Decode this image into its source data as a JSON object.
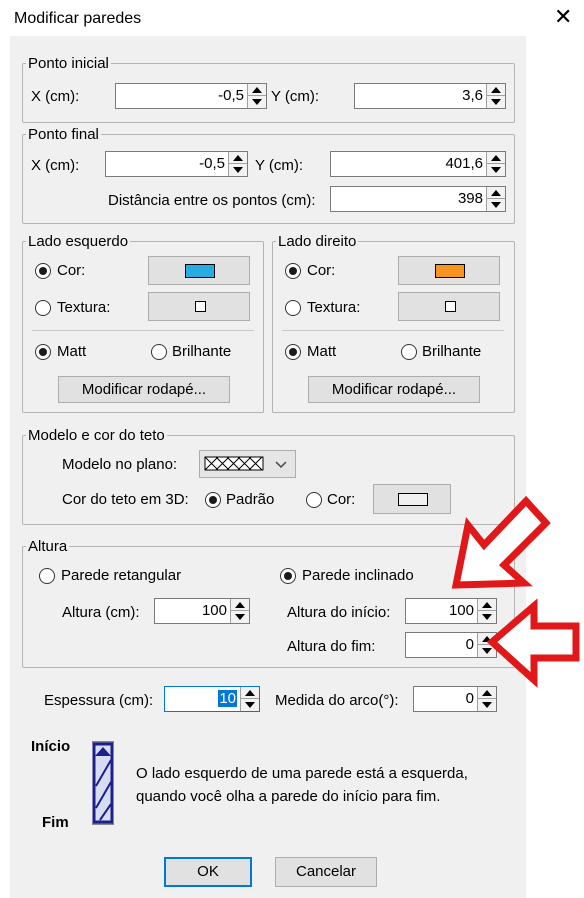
{
  "window": {
    "title": "Modificar paredes",
    "close_glyph": "✕"
  },
  "start_point": {
    "legend": "Ponto inicial",
    "x_label": "X (cm):",
    "x_value": "-0,5",
    "y_label": "Y (cm):",
    "y_value": "3,6"
  },
  "end_point": {
    "legend": "Ponto final",
    "x_label": "X (cm):",
    "x_value": "-0,5",
    "y_label": "Y (cm):",
    "y_value": "401,6",
    "distance_label": "Distância entre os pontos (cm):",
    "distance_value": "398"
  },
  "left_side": {
    "legend": "Lado esquerdo",
    "color_label": "Cor:",
    "texture_label": "Textura:",
    "matt_label": "Matt",
    "glossy_label": "Brilhante",
    "baseboard_button": "Modificar rodapé...",
    "color": "#29abe2",
    "selected": "color",
    "finish": "matt"
  },
  "right_side": {
    "legend": "Lado direito",
    "color_label": "Cor:",
    "texture_label": "Textura:",
    "matt_label": "Matt",
    "glossy_label": "Brilhante",
    "baseboard_button": "Modificar rodapé...",
    "color": "#f7941d",
    "selected": "color",
    "finish": "matt"
  },
  "ceiling": {
    "legend": "Modelo e cor do teto",
    "plan_model_label": "Modelo no plano:",
    "color3d_label": "Cor do teto em 3D:",
    "default_label": "Padrão",
    "color_label": "Cor:",
    "selected": "default",
    "swatch_color": "#f0f0f0"
  },
  "height": {
    "legend": "Altura",
    "rect_label": "Parede retangular",
    "sloped_label": "Parede inclinado",
    "selected": "sloped",
    "height_label": "Altura (cm):",
    "height_value": "100",
    "start_label": "Altura do início:",
    "start_value": "100",
    "end_label": "Altura do fim:",
    "end_value": "0"
  },
  "thickness_label": "Espessura (cm):",
  "thickness_value": "10",
  "arc_label": "Medida do arco(°):",
  "arc_value": "0",
  "diagram": {
    "start_label": "Início",
    "end_label": "Fim",
    "note_line1": "O lado esquerdo de uma parede está a esquerda,",
    "note_line2": "quando você olha a parede do início para fim."
  },
  "buttons": {
    "ok": "OK",
    "cancel": "Cancelar"
  },
  "annotation_color": "#e0181a"
}
